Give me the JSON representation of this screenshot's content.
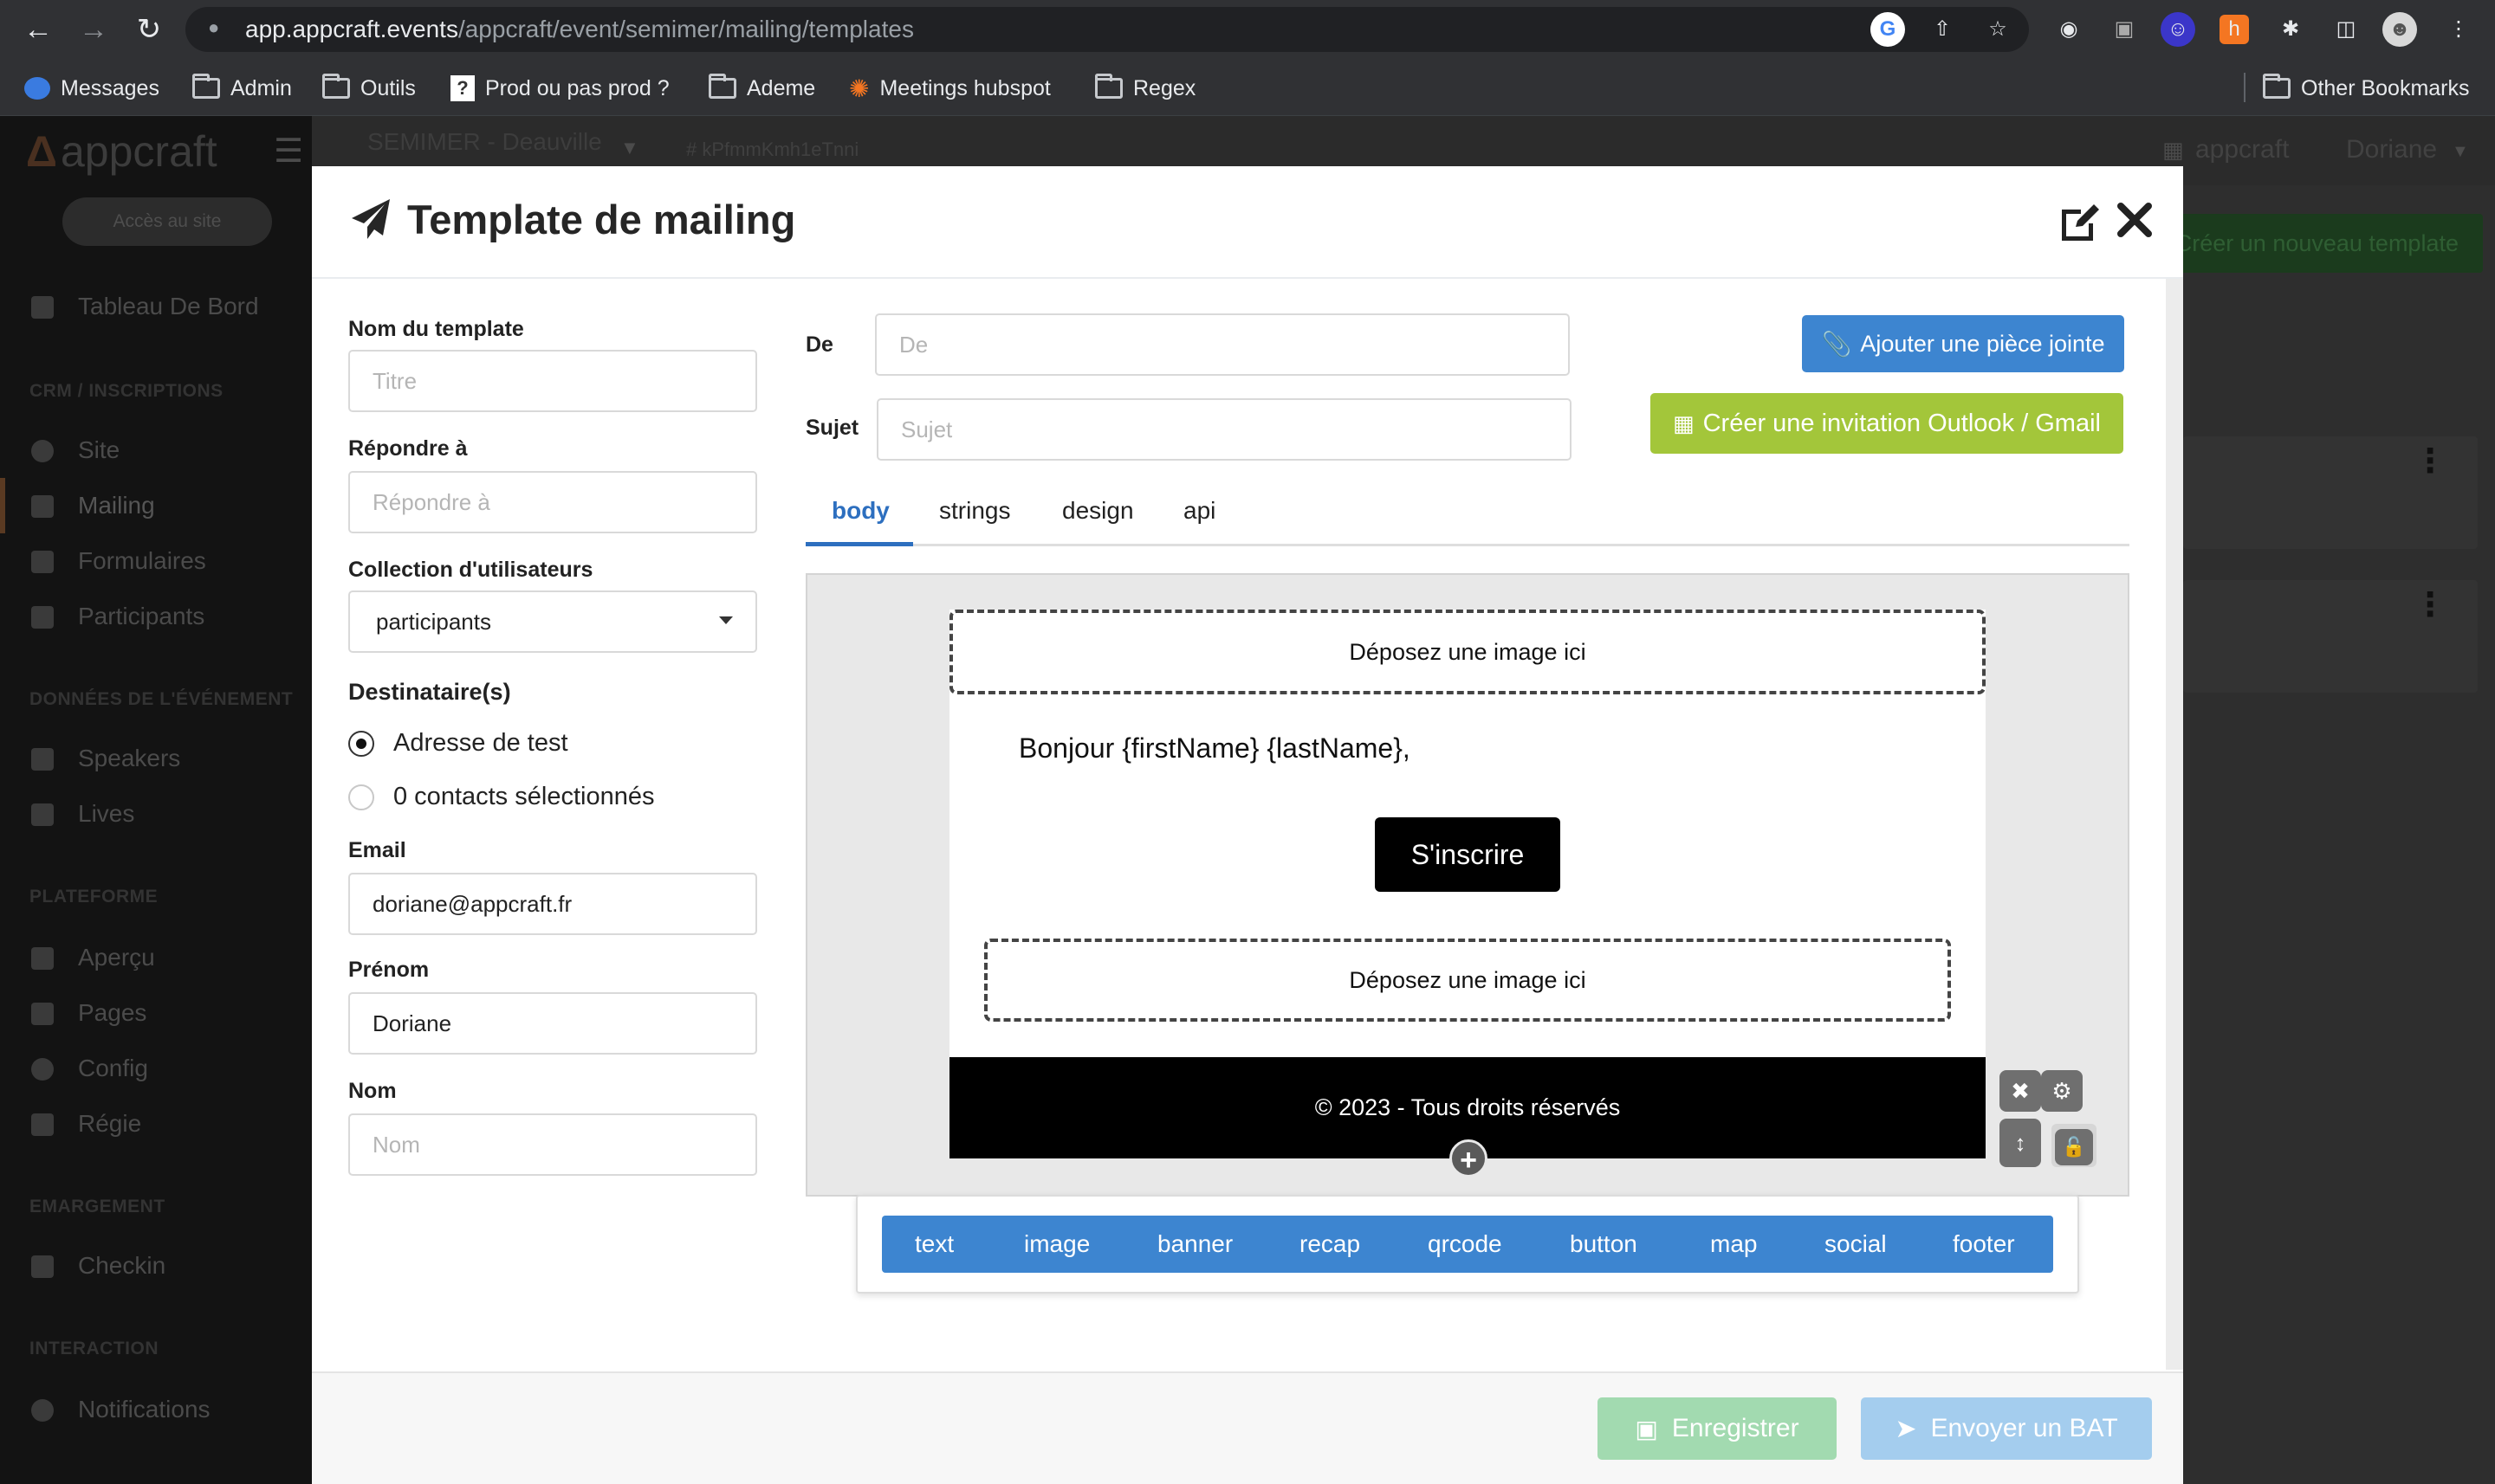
{
  "browser": {
    "url_host": "app.appcraft.events",
    "url_path": "/appcraft/event/semimer/mailing/templates",
    "bookmarks": [
      "Messages",
      "Admin",
      "Outils",
      "Prod ou pas prod ?",
      "Ademe",
      "Meetings hubspot",
      "Regex"
    ],
    "other_bookmarks": "Other Bookmarks"
  },
  "app": {
    "logo": "appcraft",
    "event_name": "SEMIMER - Deauville",
    "event_id": "# kPfmmKmh1eTnni",
    "org": "appcraft",
    "user": "Doriane",
    "site_access": "Accès au site",
    "new_template": "Créer un nouveau template",
    "sidebar": {
      "dashboard": "Tableau De Bord",
      "sec_crm": "CRM / INSCRIPTIONS",
      "site": "Site",
      "mailing": "Mailing",
      "forms": "Formulaires",
      "participants": "Participants",
      "sec_data": "DONNÉES DE L'ÉVÉNEMENT",
      "speakers": "Speakers",
      "lives": "Lives",
      "sec_platform": "PLATEFORME",
      "preview": "Aperçu",
      "pages": "Pages",
      "config": "Config",
      "rules": "Régie",
      "sec_checkin": "EMARGEMENT",
      "checkin": "Checkin",
      "sec_interaction": "INTERACTION",
      "notifications": "Notifications"
    }
  },
  "modal": {
    "title": "Template de mailing",
    "left": {
      "template_name_label": "Nom du template",
      "template_name_placeholder": "Titre",
      "reply_to_label": "Répondre à",
      "reply_to_placeholder": "Répondre à",
      "collection_label": "Collection d'utilisateurs",
      "collection_value": "participants",
      "recipients_label": "Destinataire(s)",
      "radio_test": "Adresse de test",
      "radio_selected": "0 contacts sélectionnés",
      "email_label": "Email",
      "email_value": "doriane@appcraft.fr",
      "firstname_label": "Prénom",
      "firstname_value": "Doriane",
      "lastname_label": "Nom",
      "lastname_placeholder": "Nom"
    },
    "from_label": "De",
    "from_placeholder": "De",
    "subject_label": "Sujet",
    "subject_placeholder": "Sujet",
    "attach_button": "Ajouter une pièce jointe",
    "invite_button": "Créer une invitation Outlook / Gmail",
    "tabs": [
      "body",
      "strings",
      "design",
      "api"
    ],
    "email": {
      "drop_top": "Déposez une image ici",
      "greeting": "Bonjour {firstName} {lastName},",
      "cta": "S'inscrire",
      "drop_bottom": "Déposez une image ici",
      "footer": "© 2023 - Tous droits réservés"
    },
    "blocks": [
      "text",
      "image",
      "banner",
      "recap",
      "qrcode",
      "button",
      "map",
      "social",
      "footer"
    ],
    "save_button": "Enregistrer",
    "bat_button": "Envoyer un BAT"
  },
  "colors": {
    "primary": "#3d85d0",
    "invite": "#a3c63a",
    "save_disabled": "#a2dab0",
    "bat_disabled": "#a4cdee",
    "active_tab": "#2d6fbf"
  }
}
